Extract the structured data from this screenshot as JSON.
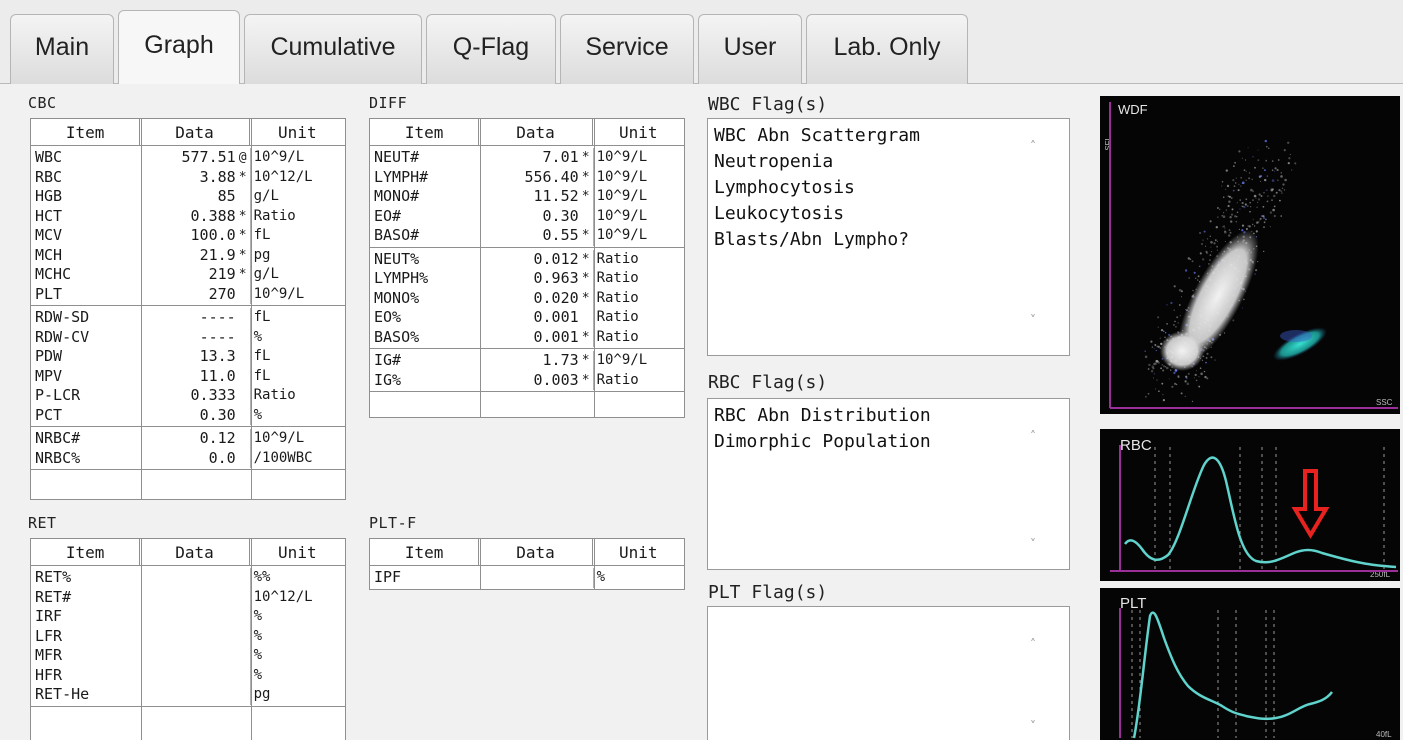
{
  "tabs": [
    {
      "label": "Main",
      "active": false
    },
    {
      "label": "Graph",
      "active": true
    },
    {
      "label": "Cumulative",
      "active": false
    },
    {
      "label": "Q-Flag",
      "active": false
    },
    {
      "label": "Service",
      "active": false
    },
    {
      "label": "User",
      "active": false
    },
    {
      "label": "Lab. Only",
      "active": false
    }
  ],
  "headers": {
    "item": "Item",
    "data": "Data",
    "unit": "Unit"
  },
  "cbc": {
    "title": "CBC",
    "groups": [
      [
        {
          "item": "WBC",
          "data": "577.51",
          "flag": "@",
          "unit": "10^9/L"
        },
        {
          "item": "RBC",
          "data": "3.88",
          "flag": "*",
          "unit": "10^12/L"
        },
        {
          "item": "HGB",
          "data": "85",
          "flag": "",
          "unit": "g/L"
        },
        {
          "item": "HCT",
          "data": "0.388",
          "flag": "*",
          "unit": "Ratio"
        },
        {
          "item": "MCV",
          "data": "100.0",
          "flag": "*",
          "unit": "fL"
        },
        {
          "item": "MCH",
          "data": "21.9",
          "flag": "*",
          "unit": "pg"
        },
        {
          "item": "MCHC",
          "data": "219",
          "flag": "*",
          "unit": "g/L"
        },
        {
          "item": "PLT",
          "data": "270",
          "flag": "",
          "unit": "10^9/L"
        }
      ],
      [
        {
          "item": "RDW-SD",
          "data": "----",
          "flag": "",
          "unit": "fL"
        },
        {
          "item": "RDW-CV",
          "data": "----",
          "flag": "",
          "unit": "%"
        },
        {
          "item": "PDW",
          "data": "13.3",
          "flag": "",
          "unit": "fL"
        },
        {
          "item": "MPV",
          "data": "11.0",
          "flag": "",
          "unit": "fL"
        },
        {
          "item": "P-LCR",
          "data": "0.333",
          "flag": "",
          "unit": "Ratio"
        },
        {
          "item": "PCT",
          "data": "0.30",
          "flag": "",
          "unit": "%"
        }
      ],
      [
        {
          "item": "NRBC#",
          "data": "0.12",
          "flag": "",
          "unit": "10^9/L"
        },
        {
          "item": "NRBC%",
          "data": "0.0",
          "flag": "",
          "unit": "/100WBC"
        }
      ]
    ]
  },
  "diff": {
    "title": "DIFF",
    "groups": [
      [
        {
          "item": "NEUT#",
          "data": "7.01",
          "flag": "*",
          "unit": "10^9/L"
        },
        {
          "item": "LYMPH#",
          "data": "556.40",
          "flag": "*",
          "unit": "10^9/L"
        },
        {
          "item": "MONO#",
          "data": "11.52",
          "flag": "*",
          "unit": "10^9/L"
        },
        {
          "item": "EO#",
          "data": "0.30",
          "flag": "",
          "unit": "10^9/L"
        },
        {
          "item": "BASO#",
          "data": "0.55",
          "flag": "*",
          "unit": "10^9/L"
        }
      ],
      [
        {
          "item": "NEUT%",
          "data": "0.012",
          "flag": "*",
          "unit": "Ratio"
        },
        {
          "item": "LYMPH%",
          "data": "0.963",
          "flag": "*",
          "unit": "Ratio"
        },
        {
          "item": "MONO%",
          "data": "0.020",
          "flag": "*",
          "unit": "Ratio"
        },
        {
          "item": "EO%",
          "data": "0.001",
          "flag": "",
          "unit": "Ratio"
        },
        {
          "item": "BASO%",
          "data": "0.001",
          "flag": "*",
          "unit": "Ratio"
        }
      ],
      [
        {
          "item": "IG#",
          "data": "1.73",
          "flag": "*",
          "unit": "10^9/L"
        },
        {
          "item": "IG%",
          "data": "0.003",
          "flag": "*",
          "unit": "Ratio"
        }
      ]
    ]
  },
  "ret": {
    "title": "RET",
    "groups": [
      [
        {
          "item": "RET%",
          "data": "",
          "flag": "",
          "unit": "%%"
        },
        {
          "item": "RET#",
          "data": "",
          "flag": "",
          "unit": "10^12/L"
        },
        {
          "item": "IRF",
          "data": "",
          "flag": "",
          "unit": "%"
        },
        {
          "item": "LFR",
          "data": "",
          "flag": "",
          "unit": "%"
        },
        {
          "item": "MFR",
          "data": "",
          "flag": "",
          "unit": "%"
        },
        {
          "item": "HFR",
          "data": "",
          "flag": "",
          "unit": "%"
        },
        {
          "item": "RET-He",
          "data": "",
          "flag": "",
          "unit": "pg"
        }
      ]
    ]
  },
  "pltf": {
    "title": "PLT-F",
    "groups": [
      [
        {
          "item": "IPF",
          "data": "",
          "flag": "",
          "unit": "%"
        }
      ]
    ]
  },
  "flags": {
    "wbc": {
      "title": "WBC Flag(s)",
      "lines": [
        "WBC Abn Scattergram",
        "Neutropenia",
        "Lymphocytosis",
        "Leukocytosis",
        "Blasts/Abn Lympho?"
      ]
    },
    "rbc": {
      "title": "RBC Flag(s)",
      "lines": [
        "RBC Abn Distribution",
        "Dimorphic Population"
      ]
    },
    "plt": {
      "title": "PLT Flag(s)",
      "lines": []
    }
  },
  "graphs": {
    "wdf": {
      "label": "WDF",
      "y_axis": "SFL",
      "x_axis": "SSC"
    },
    "rbc": {
      "label": "RBC",
      "x_max": "250fL"
    },
    "plt": {
      "label": "PLT",
      "x_max": "40fL"
    }
  },
  "colors": {
    "curve": "#5fd3cc",
    "axis": "#9a2f9a",
    "arrow": "#e8231f",
    "lymph_cluster": "#e9e9e9",
    "mono_cluster": "#2fd6c8"
  }
}
